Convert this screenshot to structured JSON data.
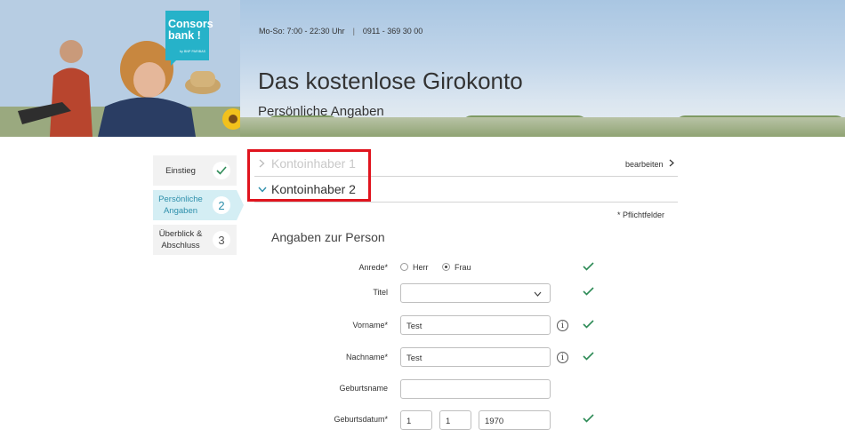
{
  "header": {
    "logo_line1": "Consors",
    "logo_line2": "bank !",
    "logo_sub": "by BNP PARIBAS",
    "hours": "Mo-So: 7:00 - 22:30 Uhr",
    "separator": "|",
    "phone": "0911 - 369 30 00",
    "title": "Das kostenlose Girokonto",
    "subtitle": "Persönliche Angaben"
  },
  "steps": [
    {
      "label": "Einstieg",
      "badge": "✓",
      "state": "done"
    },
    {
      "label": "Persönliche Angaben",
      "badge": "2",
      "state": "active"
    },
    {
      "label": "Überblick & Abschluss",
      "badge": "3",
      "state": "pending"
    }
  ],
  "accordion": {
    "holder1": "Kontoinhaber 1",
    "holder2": "Kontoinhaber 2",
    "edit_link": "bearbeiten"
  },
  "required_note": "* Pflichtfelder",
  "section_title": "Angaben zur Person",
  "form": {
    "anrede_label": "Anrede*",
    "anrede_options": [
      "Herr",
      "Frau"
    ],
    "anrede_selected": "Frau",
    "titel_label": "Titel",
    "titel_value": "",
    "vorname_label": "Vorname*",
    "vorname_value": "Test",
    "nachname_label": "Nachname*",
    "nachname_value": "Test",
    "geburtsname_label": "Geburtsname",
    "geburtsname_value": "",
    "geburtsdatum_label": "Geburtsdatum*",
    "geburtsdatum_day": "1",
    "geburtsdatum_month": "1",
    "geburtsdatum_year": "1970",
    "info_symbol": "i"
  },
  "colors": {
    "brand": "#26b2c9",
    "active_step_bg": "#d4eef4",
    "active_step_text": "#2d8fab",
    "valid_check": "#2e8b57",
    "highlight_box": "#e0141e"
  }
}
